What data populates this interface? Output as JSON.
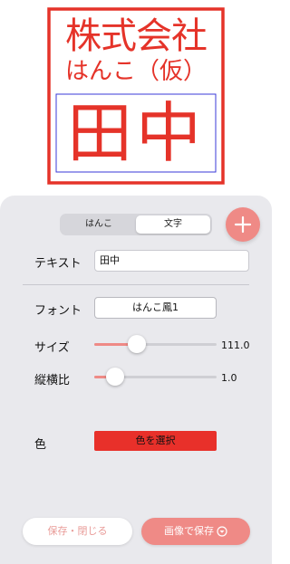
{
  "preview": {
    "line1": "株式会社",
    "line2": "はんこ（仮）",
    "main_text": "田中",
    "stamp_color": "#e53329",
    "frame_outline_color": "#3a3ad8"
  },
  "tabs": [
    {
      "label": "はんこ",
      "active": false
    },
    {
      "label": "文字",
      "active": true
    }
  ],
  "add_button": {
    "icon": "plus-icon"
  },
  "text_row": {
    "label": "テキスト",
    "value": "田中"
  },
  "font_row": {
    "label": "フォント",
    "value": "はんこ鳳1"
  },
  "size_row": {
    "label": "サイズ",
    "value": "111.0",
    "level": 0.35
  },
  "ratio_row": {
    "label": "縦横比",
    "value": "1.0",
    "level": 0.17
  },
  "color_row": {
    "label": "色",
    "button_label": "色を選択",
    "button_color": "#e8302a"
  },
  "footer": {
    "save_close_label": "保存・閉じる",
    "save_image_label": "画像で保存",
    "save_image_icon": "download-icon"
  },
  "colors": {
    "accent": "#ef8a86",
    "panel_bg": "#e9e9ed"
  }
}
